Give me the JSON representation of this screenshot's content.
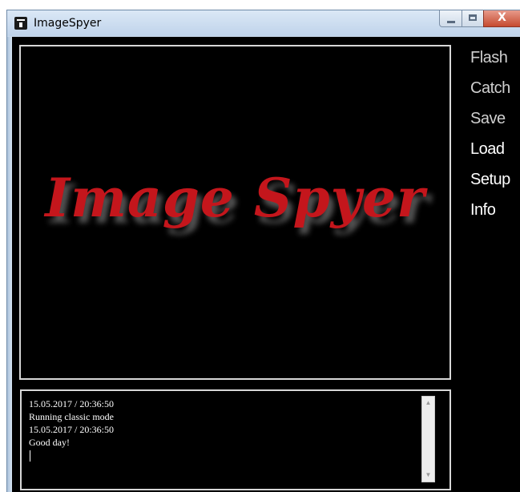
{
  "window": {
    "title": "ImageSpyer",
    "controls": {
      "minimize": "minimize",
      "maximize": "maximize",
      "close": "X"
    }
  },
  "preview": {
    "logo_text": "Image Spyer",
    "logo_color": "#c4161c"
  },
  "log": {
    "lines": [
      "15.05.2017 / 20:36:50",
      "Running classic mode",
      "15.05.2017 / 20:36:50",
      "Good day!"
    ],
    "scroll_up_glyph": "▲",
    "scroll_down_glyph": "▼"
  },
  "menu": {
    "items": [
      {
        "label": "Flash"
      },
      {
        "label": "Catch"
      },
      {
        "label": "Save"
      },
      {
        "label": "Load"
      },
      {
        "label": "Setup"
      },
      {
        "label": "Info"
      }
    ]
  },
  "colors": {
    "background": "#000000",
    "panel_border": "#d7d7d7",
    "titlebar": "#c8d8ea"
  }
}
